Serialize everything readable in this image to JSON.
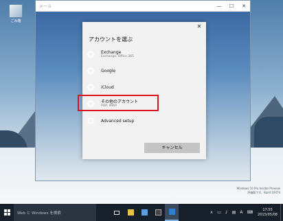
{
  "desktop": {
    "icon_label": "ごみ箱",
    "watermark_lines": [
      "Windows 10 Pro Insider Preview",
      "評価版です。Build 10074",
      "17:55",
      "2015/05/08"
    ]
  },
  "app_window": {
    "title": "メール",
    "controls": {
      "minimize": "—",
      "maximize": "☐",
      "close": "✕"
    }
  },
  "dialog": {
    "title": "アカウントを選ぶ",
    "close_label": "✕",
    "accounts": [
      {
        "name": "Exchange",
        "sub": "Exchange, Office 365",
        "icon": "gear-icon"
      },
      {
        "name": "Google",
        "sub": "",
        "icon": "gear-icon"
      },
      {
        "name": "iCloud",
        "sub": "",
        "icon": "gear-icon"
      },
      {
        "name": "その他のアカウント",
        "sub": "POP, IMAP",
        "icon": "gear-icon"
      },
      {
        "name": "Advanced setup",
        "sub": "",
        "icon": "gear-icon"
      }
    ],
    "cancel_label": "キャンセル",
    "highlight_color": "#d9141c"
  },
  "taskbar": {
    "search_placeholder": "Web と Windows を検索",
    "clock_time": "17:55",
    "clock_date": "2015/05/08",
    "tray_lang": "A",
    "accent": "#7fb2e5"
  }
}
